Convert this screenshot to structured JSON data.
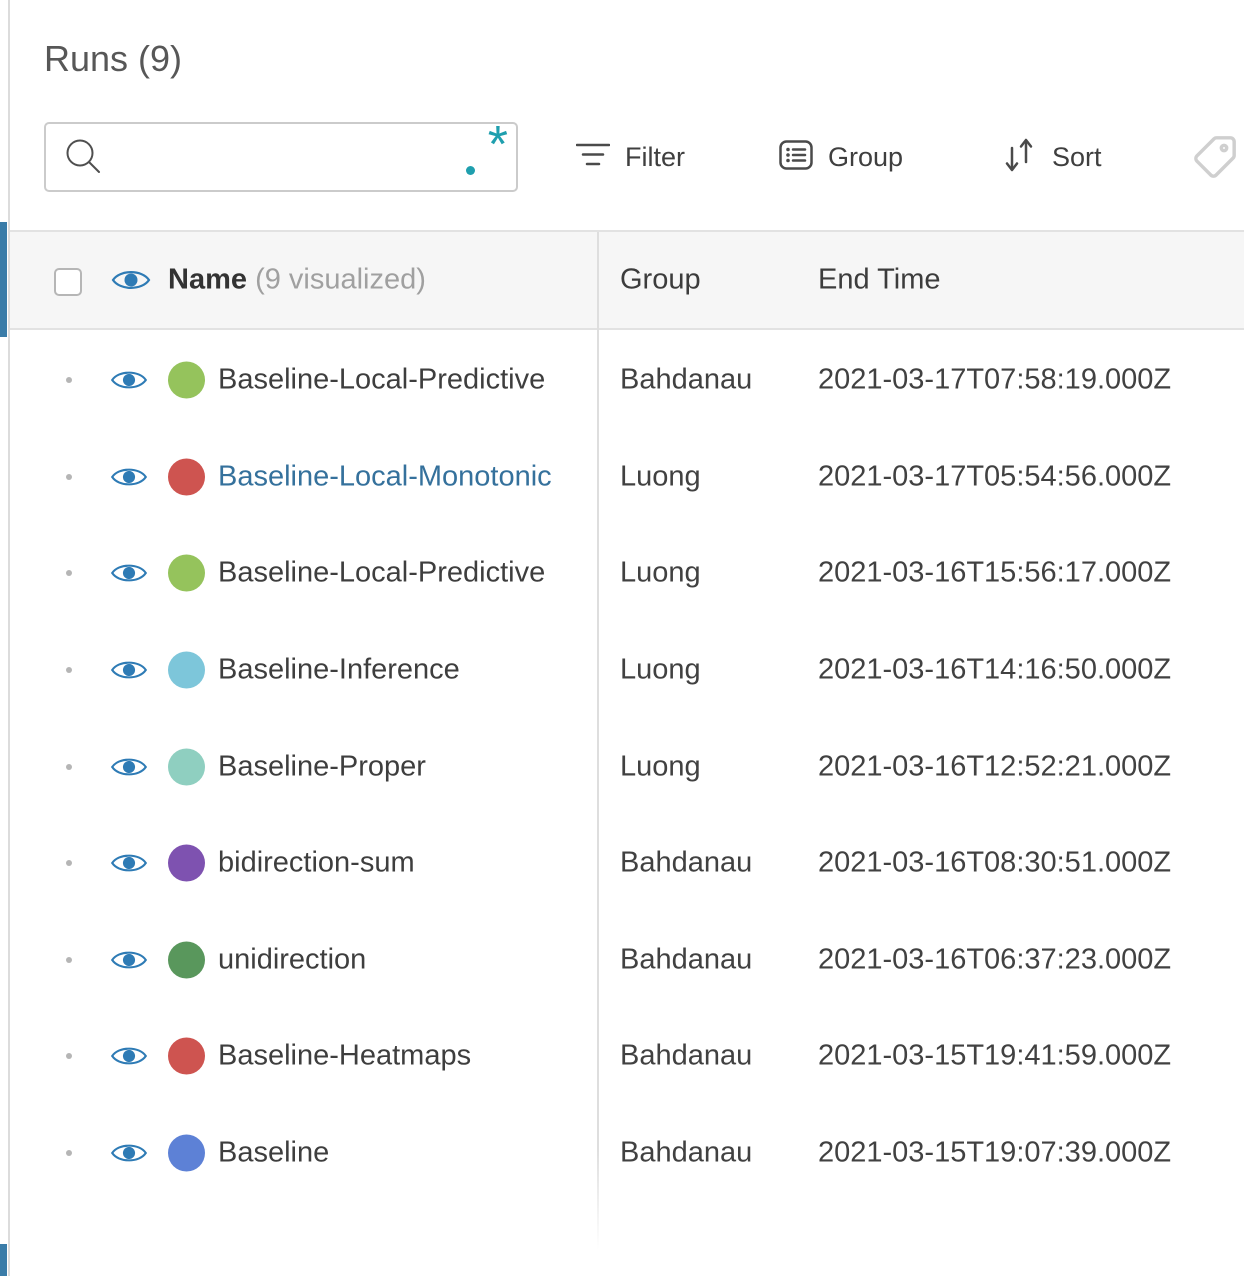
{
  "panel": {
    "title": "Runs (9)"
  },
  "search": {
    "value": "",
    "placeholder": "",
    "regex_dot": ".",
    "regex_star": "*"
  },
  "toolbar": {
    "filter_label": "Filter",
    "group_label": "Group",
    "sort_label": "Sort"
  },
  "table": {
    "header": {
      "name": "Name",
      "name_suffix": "(9 visualized)",
      "group": "Group",
      "end_time": "End Time"
    },
    "rows": [
      {
        "name": "Baseline-Local-Predictive",
        "dot_color": "#95c35c",
        "group": "Bahdanau",
        "end_time": "2021-03-17T07:58:19.000Z",
        "selected": false
      },
      {
        "name": "Baseline-Local-Monotonic",
        "dot_color": "#ce5450",
        "group": "Luong",
        "end_time": "2021-03-17T05:54:56.000Z",
        "selected": true
      },
      {
        "name": "Baseline-Local-Predictive",
        "dot_color": "#95c35c",
        "group": "Luong",
        "end_time": "2021-03-16T15:56:17.000Z",
        "selected": false
      },
      {
        "name": "Baseline-Inference",
        "dot_color": "#7dc6da",
        "group": "Luong",
        "end_time": "2021-03-16T14:16:50.000Z",
        "selected": false
      },
      {
        "name": "Baseline-Proper",
        "dot_color": "#8fcfc0",
        "group": "Luong",
        "end_time": "2021-03-16T12:52:21.000Z",
        "selected": false
      },
      {
        "name": "bidirection-sum",
        "dot_color": "#7e52b0",
        "group": "Bahdanau",
        "end_time": "2021-03-16T08:30:51.000Z",
        "selected": false
      },
      {
        "name": "unidirection",
        "dot_color": "#59975c",
        "group": "Bahdanau",
        "end_time": "2021-03-16T06:37:23.000Z",
        "selected": false
      },
      {
        "name": "Baseline-Heatmaps",
        "dot_color": "#ce5450",
        "group": "Bahdanau",
        "end_time": "2021-03-15T19:41:59.000Z",
        "selected": false
      },
      {
        "name": "Baseline",
        "dot_color": "#5d81d6",
        "group": "Bahdanau",
        "end_time": "2021-03-15T19:07:39.000Z",
        "selected": false
      }
    ]
  },
  "colors": {
    "accent_blue": "#3a7ca8",
    "eye_blue": "#2e7bb5",
    "regex_teal": "#1f9fae",
    "selected_name_link": "#35719c",
    "header_bg": "#f6f6f6"
  }
}
